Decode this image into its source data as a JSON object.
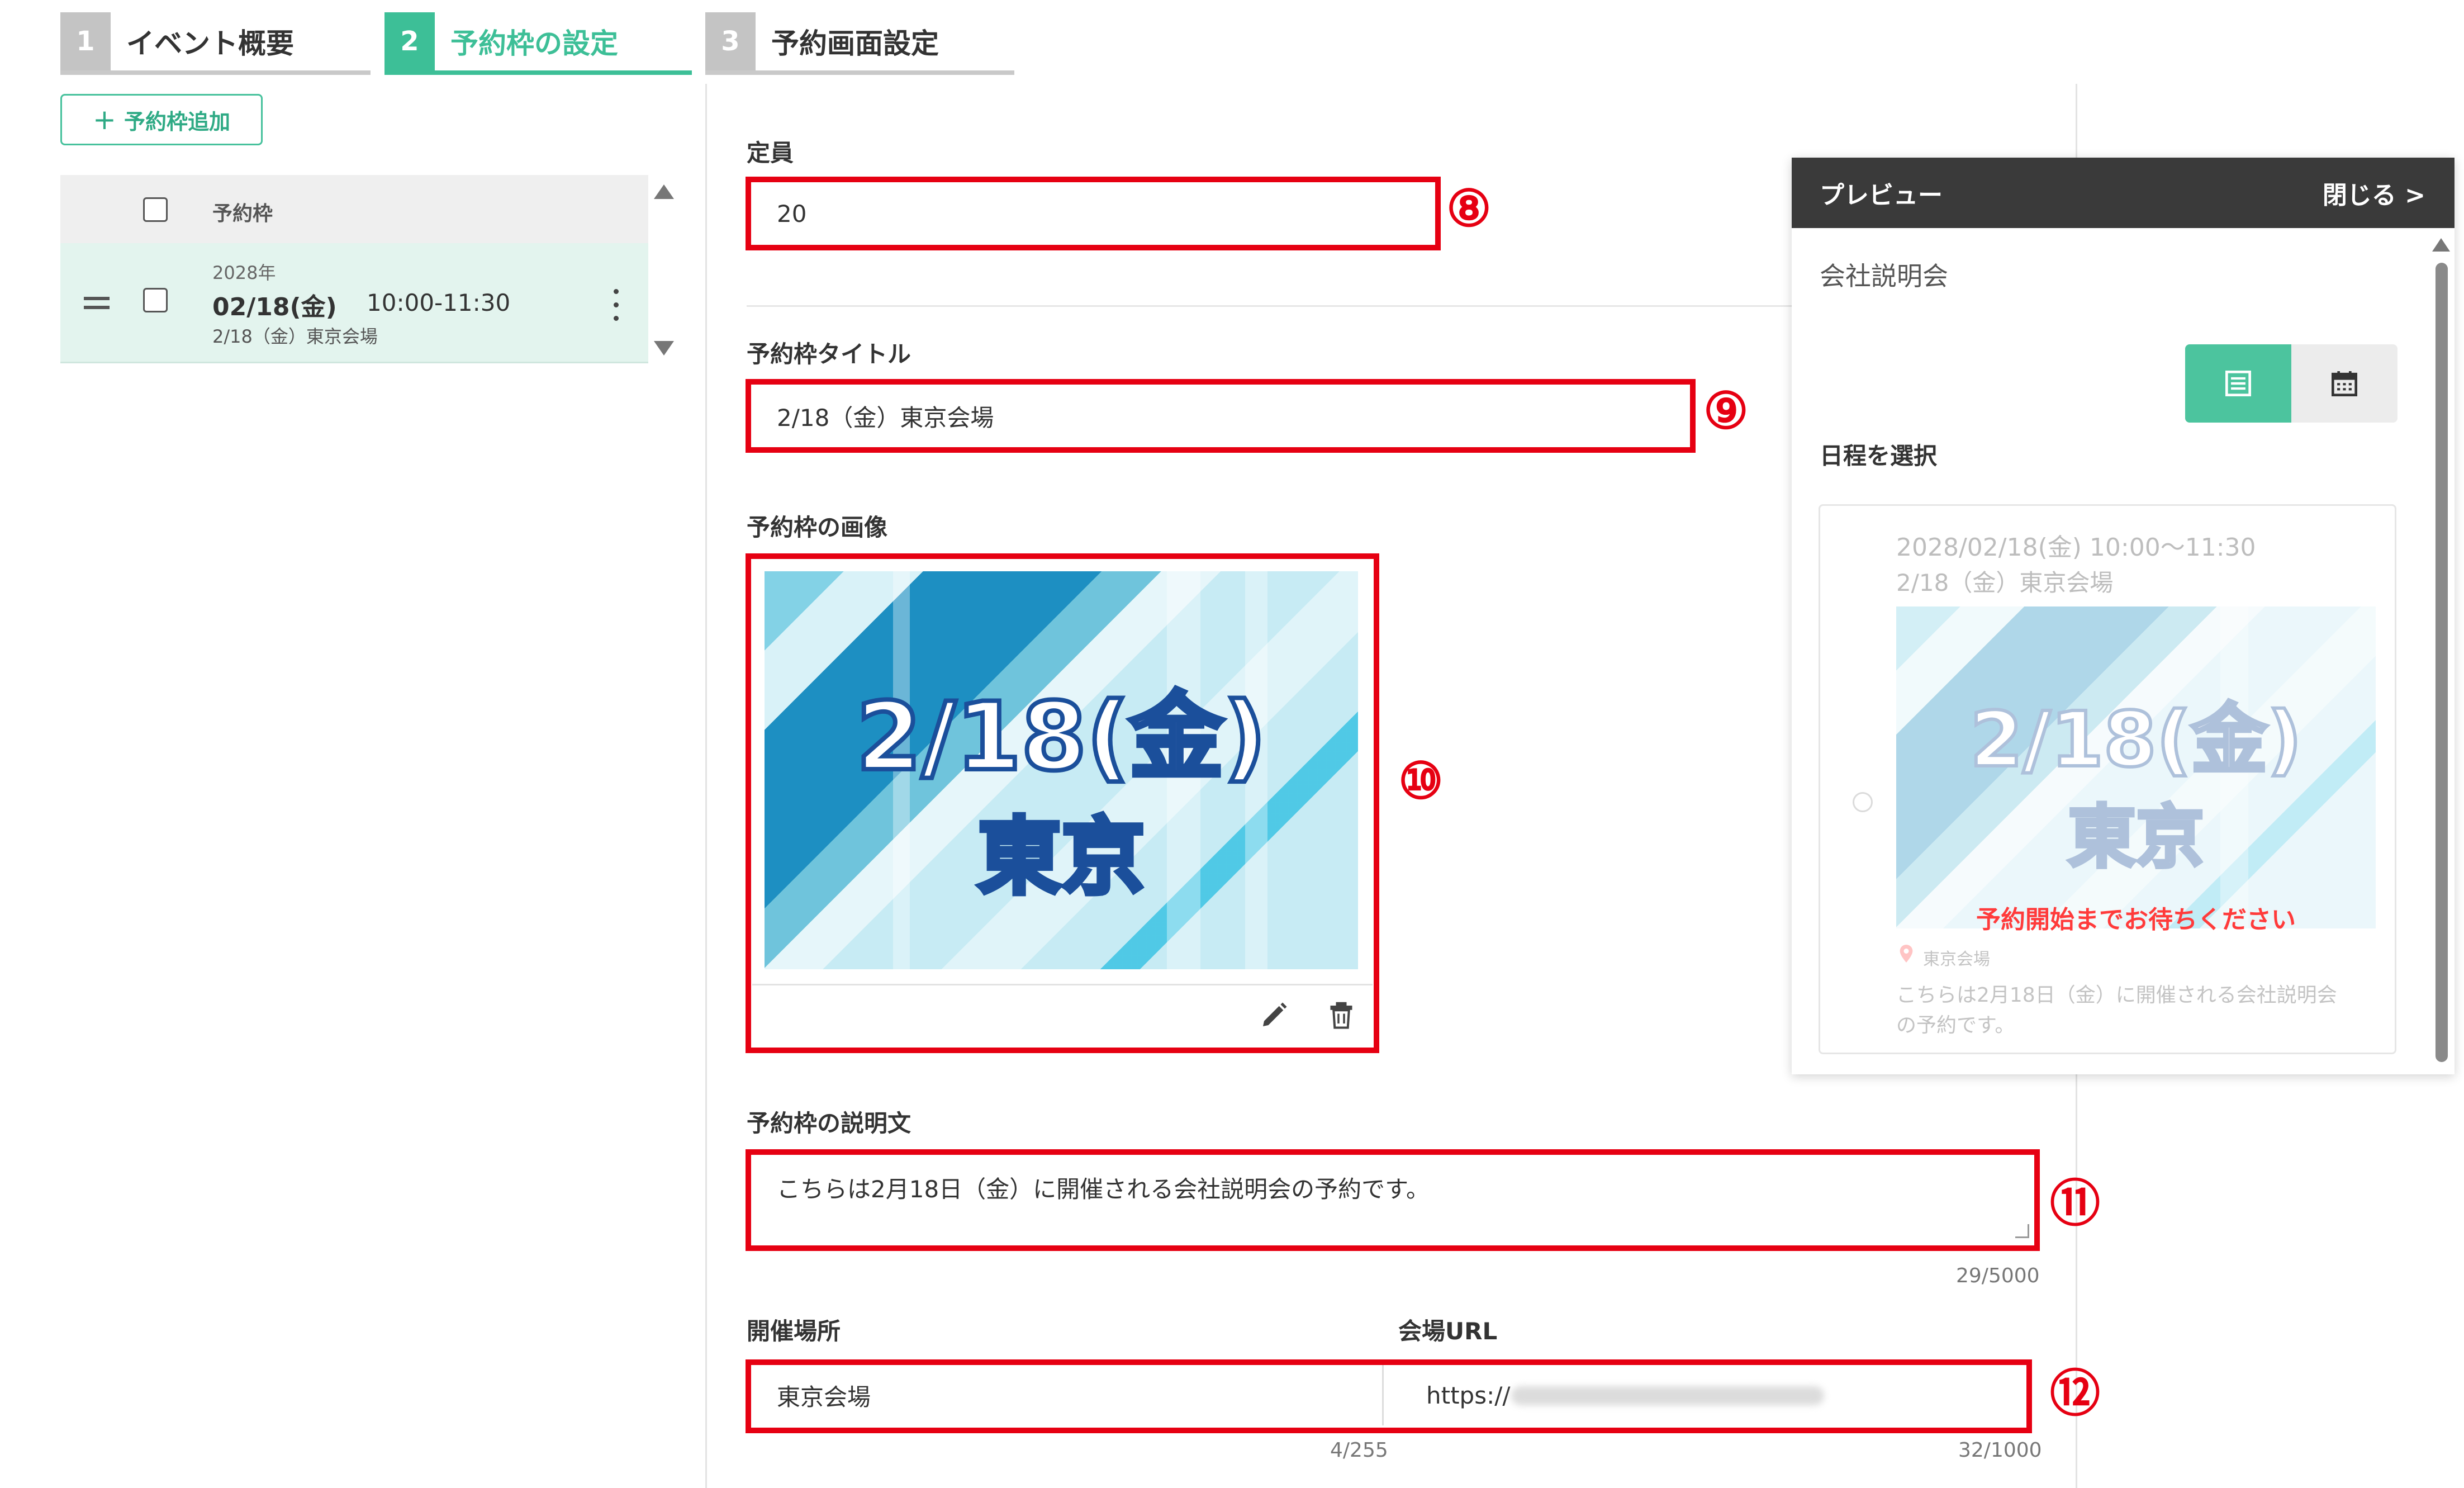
{
  "stepper": {
    "steps": [
      {
        "number": "1",
        "label": "イベント概要",
        "active": false
      },
      {
        "number": "2",
        "label": "予約枠の設定",
        "active": true
      },
      {
        "number": "3",
        "label": "予約画面設定",
        "active": false
      }
    ]
  },
  "sidebar": {
    "add_button_label": "予約枠追加",
    "list_header": "予約枠",
    "slots": [
      {
        "year": "2028年",
        "date": "02/18(金)",
        "time": "10:00-11:30",
        "title": "2/18（金）東京会場"
      }
    ]
  },
  "form": {
    "capacity": {
      "label": "定員",
      "value": "20",
      "marker": "⑧"
    },
    "slot_title": {
      "label": "予約枠タイトル",
      "value": "2/18（金）東京会場",
      "marker": "⑨"
    },
    "slot_image": {
      "label": "予約枠の画像",
      "marker": "⑩",
      "image_text_line1": "2/18(金)",
      "image_text_line2": "東京"
    },
    "description": {
      "label": "予約枠の説明文",
      "value": "こちらは2月18日（金）に開催される会社説明会の予約です。",
      "counter": "29/5000",
      "marker": "⑪"
    },
    "venue": {
      "label": "開催場所",
      "value": "東京会場",
      "counter": "4/255"
    },
    "venue_url": {
      "label": "会場URL",
      "value": "https://",
      "counter": "32/1000",
      "marker": "⑫"
    }
  },
  "preview": {
    "title": "プレビュー",
    "close_label": "閉じる >",
    "event_name": "会社説明会",
    "select_label": "日程を選択",
    "card": {
      "datetime": "2028/02/18(金) 10:00～11:30",
      "title": "2/18（金）東京会場",
      "image_text_line1": "2/18(金)",
      "image_text_line2": "東京",
      "notice": "予約開始までお待ちください",
      "location": "東京会場",
      "description_line1": "こちらは2月18日（金）に開催される会社説明会",
      "description_line2": "の予約です。"
    }
  },
  "colors": {
    "accent": "#3dbf97",
    "highlight_red": "#e60012",
    "preview_header": "#3a3a3a",
    "notice_red": "#ff3b3b"
  }
}
